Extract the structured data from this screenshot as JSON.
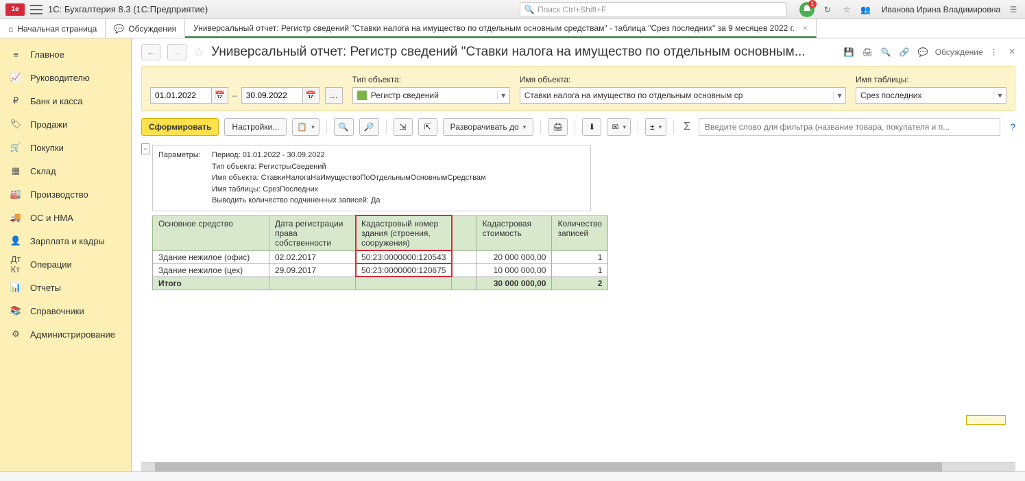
{
  "top": {
    "app_title": "1С: Бухгалтерия 8.3  (1С:Предприятие)",
    "search_placeholder": "Поиск Ctrl+Shift+F",
    "username": "Иванова Ирина Владимировна",
    "notif_count": "1"
  },
  "tabs": {
    "home": "Начальная страница",
    "discuss": "Обсуждения",
    "report": "Универсальный отчет: Регистр сведений \"Ставки налога на имущество по отдельным основным средствам\" - таблица \"Срез последних\" за 9 месяцев 2022 г."
  },
  "sidebar": {
    "items": [
      {
        "label": "Главное"
      },
      {
        "label": "Руководителю"
      },
      {
        "label": "Банк и касса"
      },
      {
        "label": "Продажи"
      },
      {
        "label": "Покупки"
      },
      {
        "label": "Склад"
      },
      {
        "label": "Производство"
      },
      {
        "label": "ОС и НМА"
      },
      {
        "label": "Зарплата и кадры"
      },
      {
        "label": "Операции"
      },
      {
        "label": "Отчеты"
      },
      {
        "label": "Справочники"
      },
      {
        "label": "Администрирование"
      }
    ]
  },
  "header": {
    "title": "Универсальный отчет: Регистр сведений \"Ставки налога на имущество по отдельным основным...",
    "discuss_label": "Обсуждение"
  },
  "params": {
    "date_from": "01.01.2022",
    "date_to": "30.09.2022",
    "type_label": "Тип объекта:",
    "type_value": "Регистр сведений",
    "name_label": "Имя объекта:",
    "name_value": "Ставки налога на имущество по отдельным основным ср",
    "table_label": "Имя таблицы:",
    "table_value": "Срез последних"
  },
  "toolbar": {
    "generate": "Сформировать",
    "settings": "Настройки...",
    "expand": "Разворачивать до",
    "filter_placeholder": "Введите слово для фильтра (название товара, покупателя и п..."
  },
  "report_params": {
    "title": "Параметры:",
    "period": "Период: 01.01.2022 - 30.09.2022",
    "type": "Тип объекта: РегистрыСведений",
    "name": "Имя объекта: СтавкиНалогаНаИмуществоПоОтдельнымОсновнымСредствам",
    "table": "Имя таблицы: СрезПоследних",
    "count": "Выводить количество подчиненных записей: Да"
  },
  "table": {
    "headers": {
      "c1": "Основное средство",
      "c2": "Дата регистрации права собственности",
      "c3": "Кадастровый номер здания (строения, сооружения)",
      "c4": "",
      "c5": "Кадастровая стоимость",
      "c6": "Количество записей"
    },
    "rows": [
      {
        "c1": "Здание нежилое (офис)",
        "c2": "02.02.2017",
        "c3": "50:23:0000000:120543",
        "c4": "",
        "c5": "20 000 000,00",
        "c6": "1"
      },
      {
        "c1": "Здание нежилое (цех)",
        "c2": "29.09.2017",
        "c3": "50:23:0000000:120675",
        "c4": "",
        "c5": "10 000 000,00",
        "c6": "1"
      }
    ],
    "total": {
      "label": "Итого",
      "c5": "30 000 000,00",
      "c6": "2"
    }
  }
}
